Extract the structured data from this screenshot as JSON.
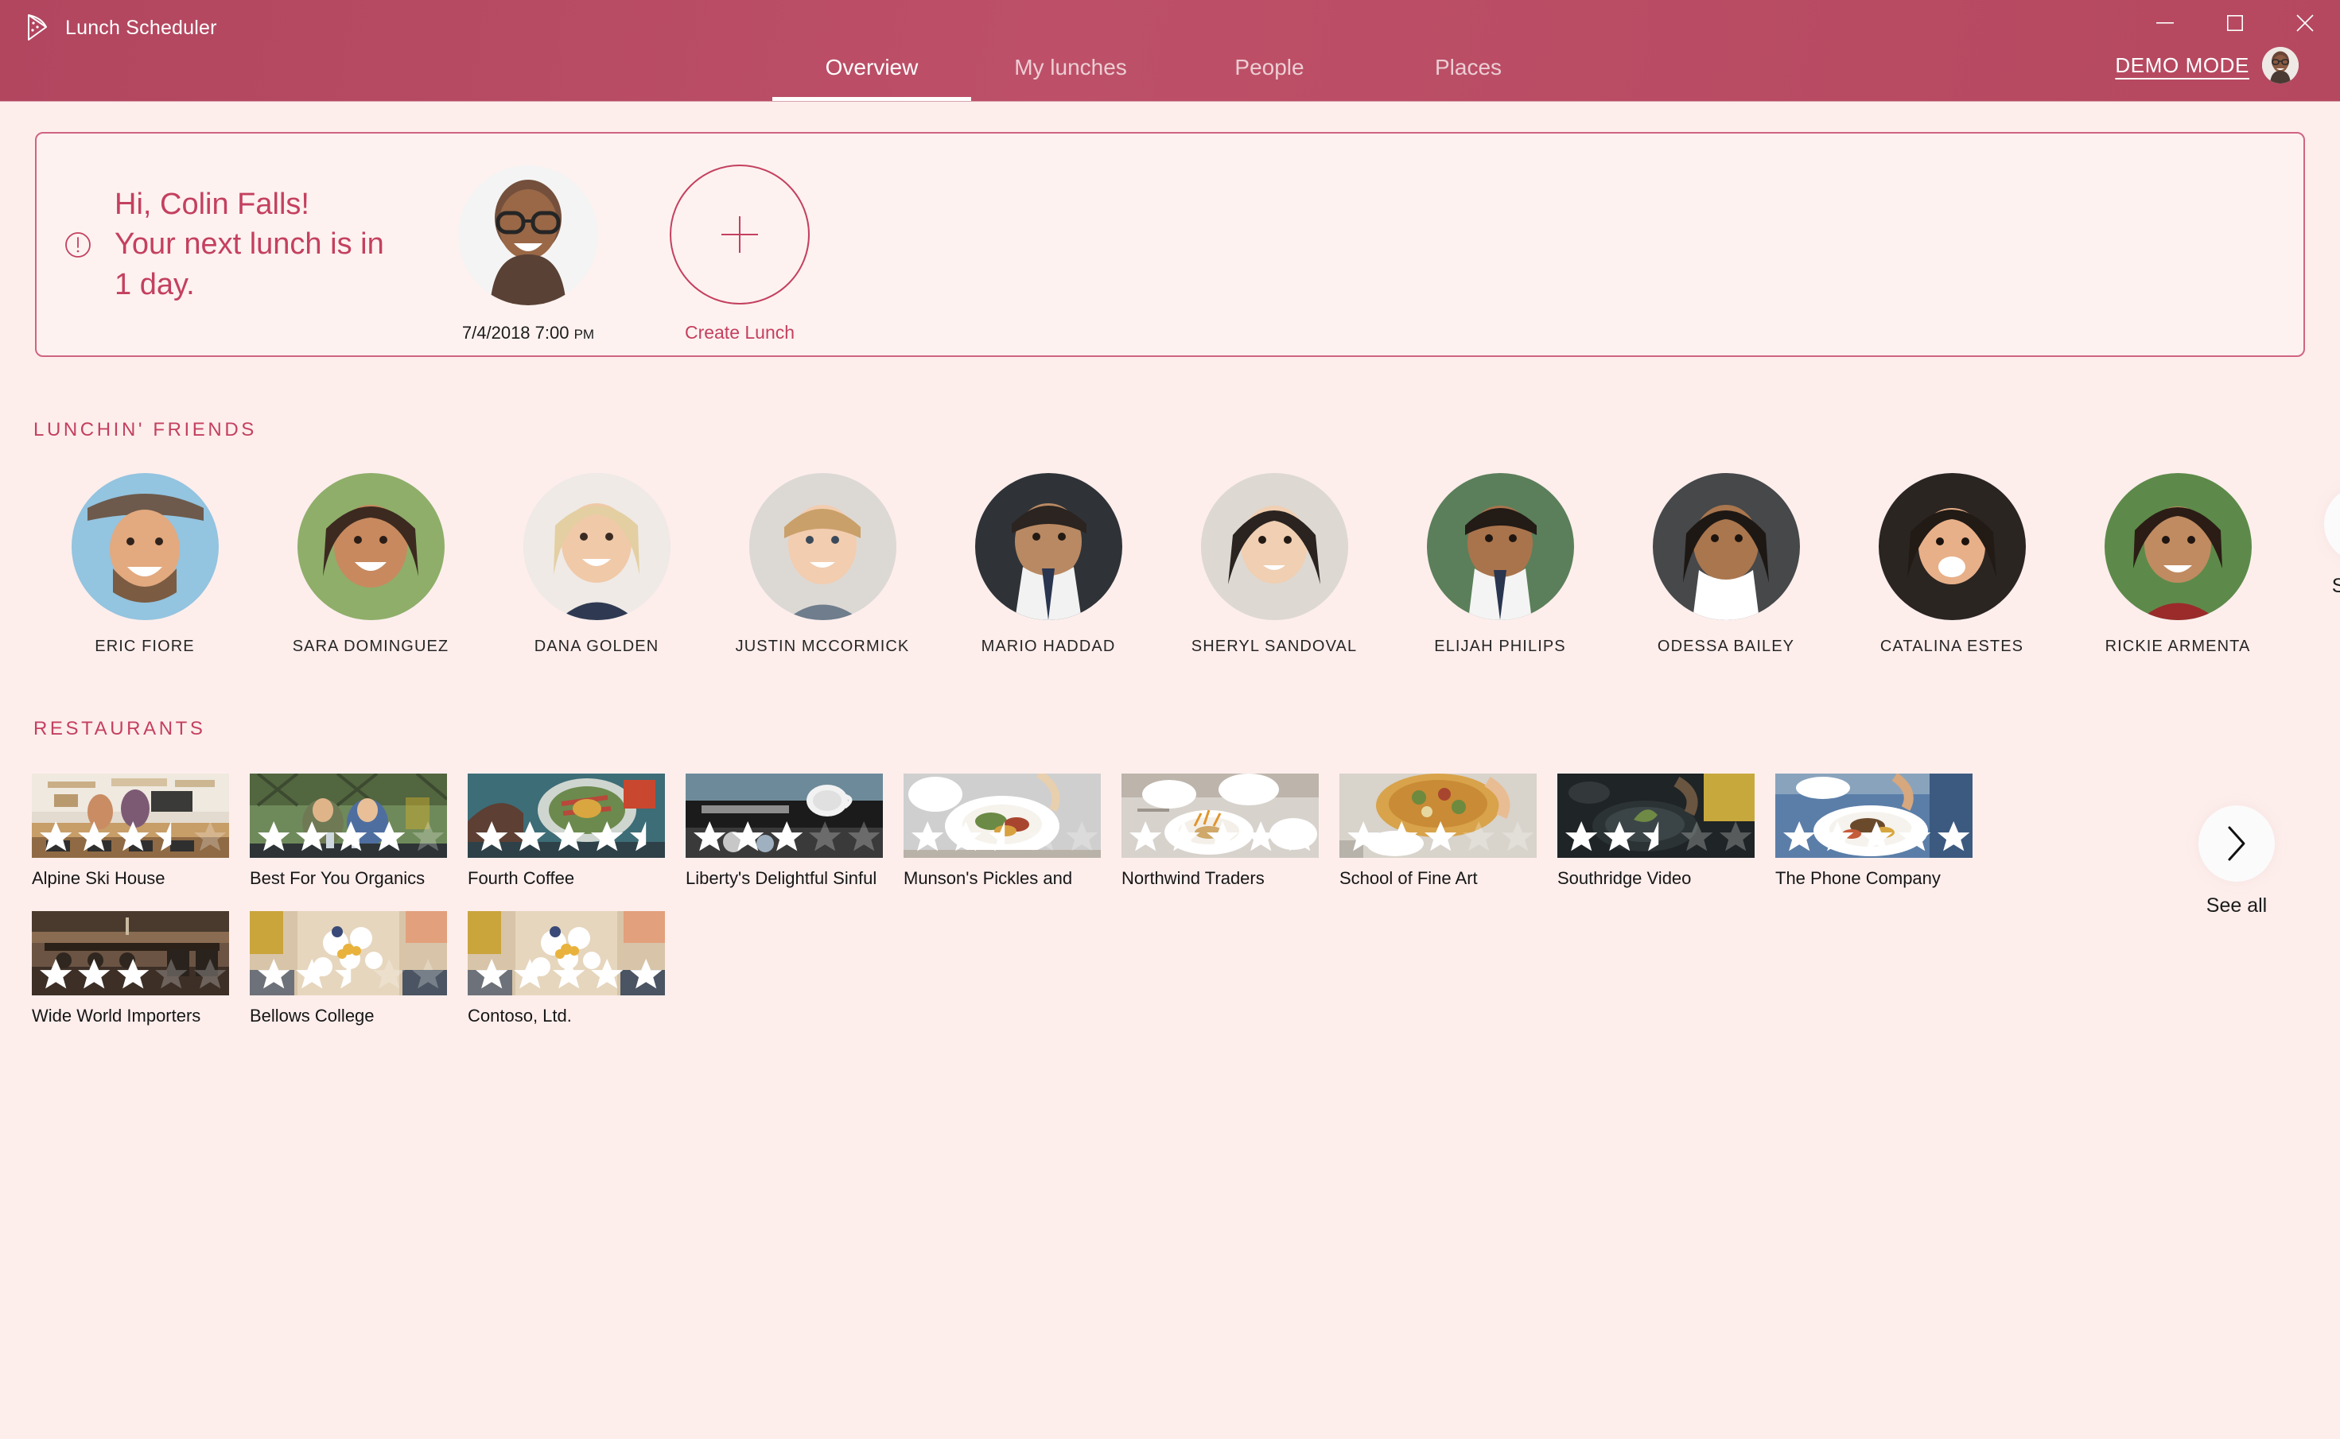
{
  "window": {
    "title": "Lunch Scheduler",
    "logo_icon": "pizza-slice-icon",
    "minimize_icon": "minimize-icon",
    "maximize_icon": "maximize-icon",
    "close_icon": "close-icon"
  },
  "nav": {
    "tabs": [
      {
        "label": "Overview",
        "active": true
      },
      {
        "label": "My lunches",
        "active": false
      },
      {
        "label": "People",
        "active": false
      },
      {
        "label": "Places",
        "active": false
      }
    ],
    "demo_mode_label": "DEMO MODE"
  },
  "greeting": {
    "alert_icon": "alert-circle-icon",
    "line1": "Hi, Colin Falls!",
    "line2": "Your next lunch is in",
    "line3": "1 day.",
    "next_lunch_date": "7/4/2018 7:00 ",
    "next_lunch_ampm": "PM",
    "create_lunch_label": "Create Lunch",
    "plus_icon": "plus-icon"
  },
  "friends_section": {
    "title": "LUNCHIN' FRIENDS",
    "see_all_label": "See all",
    "chevron_icon": "chevron-right-icon",
    "friends": [
      {
        "name": "ERIC FIORE"
      },
      {
        "name": "SARA DOMINGUEZ"
      },
      {
        "name": "DANA GOLDEN"
      },
      {
        "name": "JUSTIN MCCORMICK"
      },
      {
        "name": "MARIO HADDAD"
      },
      {
        "name": "SHERYL SANDOVAL"
      },
      {
        "name": "ELIJAH PHILIPS"
      },
      {
        "name": "ODESSA BAILEY"
      },
      {
        "name": "CATALINA ESTES"
      },
      {
        "name": "RICKIE ARMENTA"
      }
    ]
  },
  "restaurants_section": {
    "title": "RESTAURANTS",
    "see_all_label": "See all",
    "chevron_icon": "chevron-right-icon",
    "restaurants": [
      {
        "name": "Alpine Ski House",
        "rating": 3.5
      },
      {
        "name": "Best For You Organics",
        "rating": 4
      },
      {
        "name": "Fourth Coffee",
        "rating": 4.5
      },
      {
        "name": "Liberty's Delightful Sinful",
        "rating": 3
      },
      {
        "name": "Munson's Pickles and",
        "rating": 2.5
      },
      {
        "name": "Northwind Traders",
        "rating": 5
      },
      {
        "name": "School of Fine Art",
        "rating": 3
      },
      {
        "name": "Southridge Video",
        "rating": 2.5
      },
      {
        "name": "The Phone Company",
        "rating": 5
      },
      {
        "name": "Wide World Importers",
        "rating": 3
      },
      {
        "name": "Bellows College",
        "rating": 2.5
      },
      {
        "name": "Contoso, Ltd.",
        "rating": 5
      }
    ]
  },
  "colors": {
    "brand": "#b64a63",
    "accent": "#c4405f",
    "page_bg": "#fdeeec",
    "card_bg": "#fdf2f0"
  }
}
